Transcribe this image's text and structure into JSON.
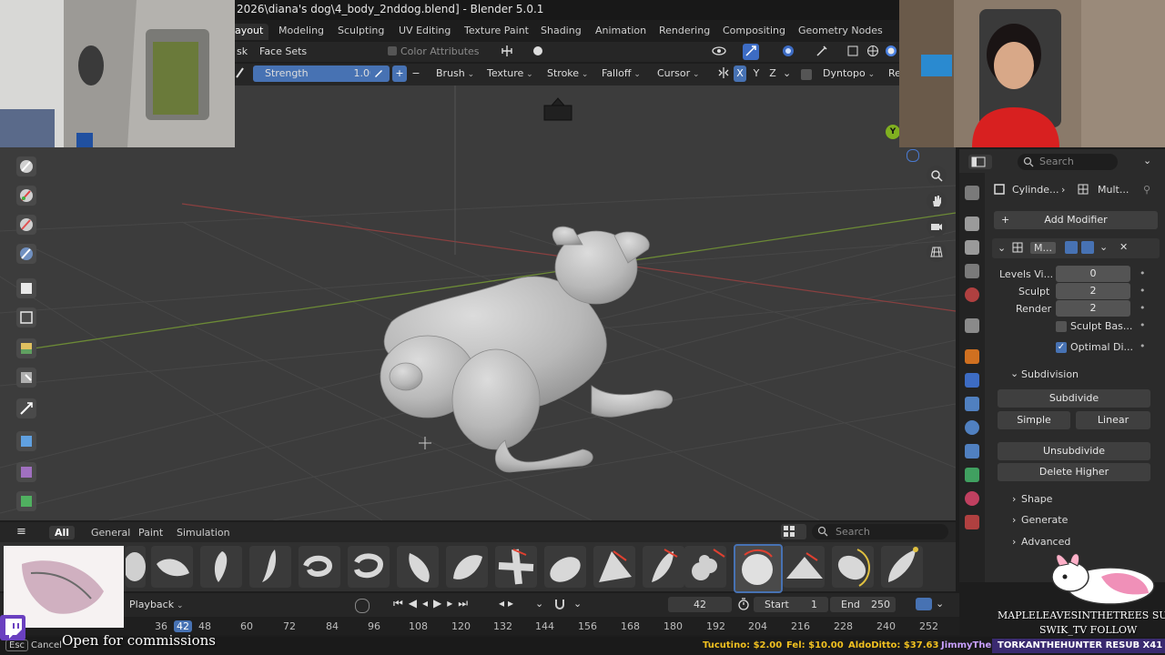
{
  "window": {
    "title": "2026\\diana's dog\\4_body_2nddog.blend] - Blender 5.0.1"
  },
  "workspace_tabs": [
    "ayout",
    "Modeling",
    "Sculpting",
    "UV Editing",
    "Texture Paint",
    "Shading",
    "Animation",
    "Rendering",
    "Compositing",
    "Geometry Nodes"
  ],
  "header": {
    "mask_label": "sk",
    "face_sets_label": "Face Sets",
    "color_attributes_label": "Color Attributes",
    "strength_label": "Strength",
    "strength_value": "1.000",
    "plus": "+",
    "minus": "−",
    "brush_label": "Brush",
    "texture_label": "Texture",
    "stroke_label": "Stroke",
    "falloff_label": "Falloff",
    "cursor_label": "Cursor",
    "axis_x": "X",
    "axis_y": "Y",
    "axis_z": "Z",
    "dyntopo_label": "Dyntopo",
    "remesh_label": "Re"
  },
  "gizmo": {
    "y_label": "Y"
  },
  "properties": {
    "search_placeholder": "Search",
    "breadcrumb_object": "Cylinde...",
    "breadcrumb_modifier": "Mult...",
    "add_modifier_label": "Add Modifier",
    "modifier_name": "M...",
    "levels_viewport_label": "Levels Vi...",
    "levels_viewport_value": "0",
    "sculpt_label": "Sculpt",
    "sculpt_value": "2",
    "render_label": "Render",
    "render_value": "2",
    "sculpt_base_label": "Sculpt Bas...",
    "optimal_display_label": "Optimal Di...",
    "subdivision_section": "Subdivision",
    "subdivide_label": "Subdivide",
    "simple_label": "Simple",
    "linear_label": "Linear",
    "unsubdivide_label": "Unsubdivide",
    "delete_higher_label": "Delete Higher",
    "shape_section": "Shape",
    "generate_section": "Generate",
    "advanced_section": "Advanced"
  },
  "asset_shelf": {
    "tabs": [
      "All",
      "General",
      "Paint",
      "Simulation"
    ],
    "search_placeholder": "Search"
  },
  "timeline": {
    "playback_label": "Playback",
    "current_frame": "42",
    "start_label": "Start",
    "start_value": "1",
    "end_label": "End",
    "end_value": "250",
    "ruler": [
      "36",
      "42",
      "48",
      "60",
      "72",
      "84",
      "96",
      "108",
      "120",
      "132",
      "144",
      "156",
      "168",
      "180",
      "192",
      "204",
      "216",
      "228",
      "240",
      "252"
    ]
  },
  "status": {
    "esc_label": "Esc",
    "cancel_label": "Cancel"
  },
  "stream_overlay": {
    "commissions_text": "Open for commissions",
    "donations": [
      {
        "text": "Tucutino: $2.00",
        "color": "#f0c020"
      },
      {
        "text": "Fel: $10.00",
        "color": "#f0c020"
      },
      {
        "text": "AldoDitto: $37.63",
        "color": "#f0c020"
      },
      {
        "text": "JimmyTheB",
        "color": "#c8a0ff"
      }
    ],
    "ticker_text": "TORKANTHEHUNTER  RESUB X41",
    "sub_line": "MAPLELEAVESINTHETREES SUB",
    "follow_line": "SWIK_TV FOLLOW"
  }
}
